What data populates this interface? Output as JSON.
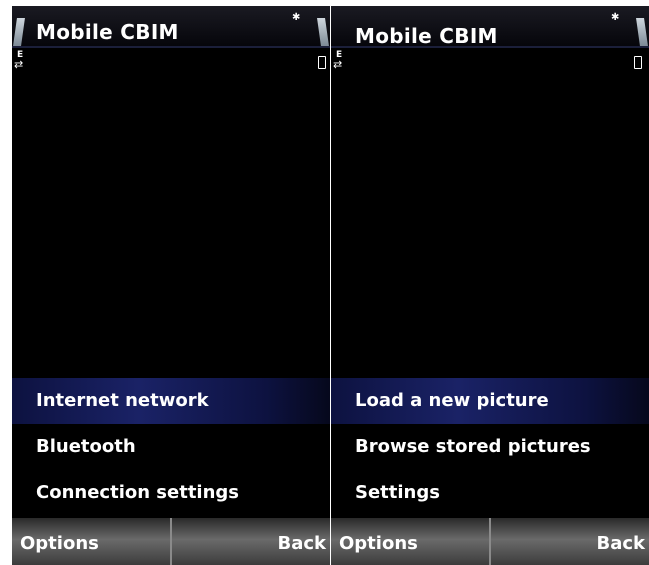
{
  "screens": [
    {
      "title": "Mobile CBIM",
      "network_indicator": "E",
      "menu_items": [
        "Internet network",
        "Bluetooth",
        "Connection settings"
      ],
      "selected_index": 0,
      "softkey_left": "Options",
      "softkey_right": "Back"
    },
    {
      "title": "Mobile CBIM",
      "network_indicator": "E",
      "menu_items": [
        "Load a new picture",
        "Browse stored pictures",
        "Settings"
      ],
      "selected_index": 0,
      "softkey_left": "Options",
      "softkey_right": "Back"
    }
  ],
  "icons": {
    "bluetooth": "bluetooth-icon",
    "signal": "signal-strength-icon",
    "battery": "battery-level-icon",
    "edge": "edge-data-icon",
    "battery_small": "battery-icon"
  },
  "colors": {
    "selection": "#1a2266",
    "background": "#000000",
    "text": "#ffffff"
  }
}
